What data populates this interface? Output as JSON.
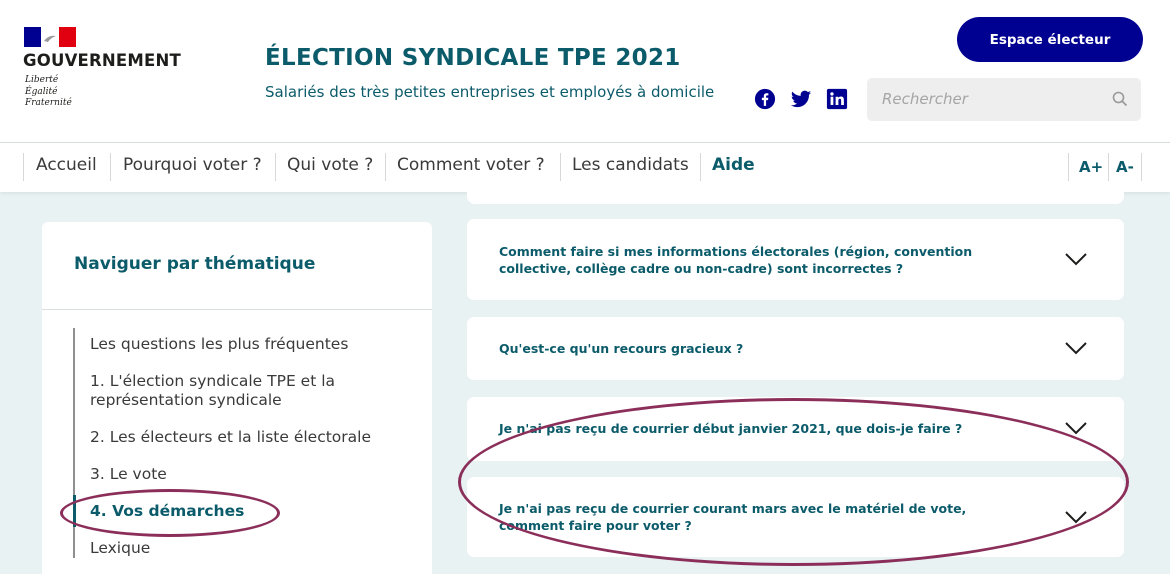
{
  "government": {
    "name": "GOUVERNEMENT",
    "motto": [
      "Liberté",
      "Égalité",
      "Fraternité"
    ]
  },
  "site": {
    "title": "ÉLECTION SYNDICALE TPE 2021",
    "subtitle": "Salariés des très petites entreprises et employés à domicile"
  },
  "header": {
    "espace_button": "Espace électeur",
    "search_placeholder": "Rechercher",
    "social_icons": [
      "facebook-icon",
      "twitter-icon",
      "linkedin-icon"
    ]
  },
  "nav": {
    "items": [
      {
        "label": "Accueil",
        "active": false
      },
      {
        "label": "Pourquoi voter ?",
        "active": false
      },
      {
        "label": "Qui vote ?",
        "active": false
      },
      {
        "label": "Comment voter ?",
        "active": false
      },
      {
        "label": "Les candidats",
        "active": false
      },
      {
        "label": "Aide",
        "active": true
      }
    ],
    "font_increase": "A+",
    "font_decrease": "A-"
  },
  "sidebar": {
    "title": "Naviguer par thématique",
    "items": [
      {
        "label": "Les questions les plus fréquentes",
        "active": false
      },
      {
        "label": "1. L'élection syndicale TPE et la représentation syndicale",
        "active": false
      },
      {
        "label": "2. Les électeurs et la liste électorale",
        "active": false
      },
      {
        "label": "3. Le vote",
        "active": false
      },
      {
        "label": "4. Vos démarches",
        "active": true
      },
      {
        "label": "Lexique",
        "active": false
      }
    ]
  },
  "faq": {
    "questions": [
      "Comment faire si mes informations électorales (région, convention collective, collège cadre ou non-cadre) sont incorrectes ?",
      "Qu'est-ce qu'un recours gracieux ?",
      "Je n'ai pas reçu de courrier début janvier 2021, que dois-je faire ?",
      "Je n'ai pas reçu de courrier courant mars avec le matériel de vote, comment faire pour voter ?"
    ]
  },
  "colors": {
    "brand_blue": "#000091",
    "brand_red": "#e1000f",
    "teal": "#0b5b6a",
    "annotation": "#8b2f5a",
    "background": "#e9f2f3"
  }
}
